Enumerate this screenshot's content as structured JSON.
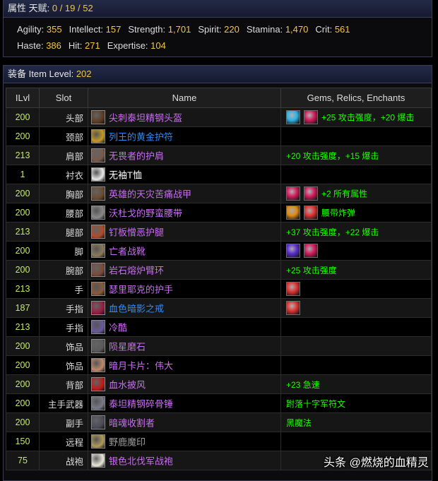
{
  "header": {
    "label": "属性 天赋:",
    "talents": "0 / 19 / 52"
  },
  "stats_row1": [
    {
      "label": "Agility:",
      "value": "355"
    },
    {
      "label": "Intellect:",
      "value": "157"
    },
    {
      "label": "Strength:",
      "value": "1,701"
    },
    {
      "label": "Spirit:",
      "value": "220"
    },
    {
      "label": "Stamina:",
      "value": "1,470"
    },
    {
      "label": "Crit:",
      "value": "561"
    }
  ],
  "stats_row2": [
    {
      "label": "Haste:",
      "value": "386"
    },
    {
      "label": "Hit:",
      "value": "271"
    },
    {
      "label": "Expertise:",
      "value": "104"
    }
  ],
  "equip": {
    "label": "装备 Item Level:",
    "ilvl": "202"
  },
  "columns": [
    "ILvl",
    "Slot",
    "Name",
    "Gems, Relics, Enchants"
  ],
  "colors": {
    "epic": "#c76ef0",
    "rare": "#2a8cff",
    "common": "#ffffff",
    "poor": "#9d9d9d",
    "ilvl": "#c6e86a",
    "enchant": "#1eff00",
    "gold": "#f2c641"
  },
  "rows": [
    {
      "ilvl": "200",
      "slot": "头部",
      "name": "尖刺泰坦精钢头盔",
      "quality": "epic",
      "icon_color": "#5b3a20",
      "gems": [
        "#2bb3e6",
        "#d4195a"
      ],
      "enchant": "+25 攻击强度，+20 爆击"
    },
    {
      "ilvl": "200",
      "slot": "颈部",
      "name": "列王的黄金护符",
      "quality": "rare",
      "icon_color": "#c79a22",
      "gems": [],
      "enchant": ""
    },
    {
      "ilvl": "213",
      "slot": "肩部",
      "name": "无畏者的护肩",
      "quality": "epic",
      "icon_color": "#7a5a4a",
      "gems": [],
      "enchant": "+20 攻击强度，+15 爆击"
    },
    {
      "ilvl": "1",
      "slot": "衬衣",
      "name": "无袖T恤",
      "quality": "common",
      "icon_color": "#e8e8e8",
      "gems": [],
      "enchant": ""
    },
    {
      "ilvl": "200",
      "slot": "胸部",
      "name": "英雄的天灾苦痛战甲",
      "quality": "epic",
      "icon_color": "#6a4a30",
      "gems": [
        "#d4195a",
        "#d4195a"
      ],
      "enchant": "+2 所有属性"
    },
    {
      "ilvl": "200",
      "slot": "腰部",
      "name": "沃杜戈的野蛮腰带",
      "quality": "epic",
      "icon_color": "#8a8a8a",
      "gems": [
        "#e08a12",
        "#e03030"
      ],
      "enchant": "腰带炸弹"
    },
    {
      "ilvl": "213",
      "slot": "腿部",
      "name": "钉板憎恶护腿",
      "quality": "epic",
      "icon_color": "#b04a2a",
      "gems": [],
      "enchant": "+37 攻击强度，+22 爆击"
    },
    {
      "ilvl": "200",
      "slot": "脚",
      "name": "亡者战靴",
      "quality": "epic",
      "icon_color": "#8a7a5a",
      "gems": [
        "#5a2ad4",
        "#d4195a"
      ],
      "enchant": ""
    },
    {
      "ilvl": "200",
      "slot": "腕部",
      "name": "岩石熔炉臂环",
      "quality": "epic",
      "icon_color": "#7a4a3a",
      "gems": [],
      "enchant": "+25 攻击强度"
    },
    {
      "ilvl": "213",
      "slot": "手",
      "name": "瑟里耶克的护手",
      "quality": "epic",
      "icon_color": "#8a5a3a",
      "gems": [
        "#e03030"
      ],
      "enchant": ""
    },
    {
      "ilvl": "187",
      "slot": "手指",
      "name": "血色暗影之戒",
      "quality": "rare",
      "icon_color": "#9a1a40",
      "gems": [
        "#e03030"
      ],
      "enchant": ""
    },
    {
      "ilvl": "213",
      "slot": "手指",
      "name": "冷酷",
      "quality": "epic",
      "icon_color": "#6a5aa0",
      "gems": [],
      "enchant": ""
    },
    {
      "ilvl": "200",
      "slot": "饰品",
      "name": "陨星磨石",
      "quality": "epic",
      "icon_color": "#5a5a5a",
      "gems": [],
      "enchant": ""
    },
    {
      "ilvl": "200",
      "slot": "饰品",
      "name": "暗月卡片：伟大",
      "quality": "epic",
      "icon_color": "#c08a6a",
      "gems": [],
      "enchant": ""
    },
    {
      "ilvl": "200",
      "slot": "背部",
      "name": "血水披风",
      "quality": "epic",
      "icon_color": "#c01818",
      "gems": [],
      "enchant": "+23 急速"
    },
    {
      "ilvl": "200",
      "slot": "主手武器",
      "name": "泰坦精钢碎骨锤",
      "quality": "epic",
      "icon_color": "#7a7a8a",
      "gems": [],
      "enchant": "跗落十字军符文"
    },
    {
      "ilvl": "200",
      "slot": "副手",
      "name": "暗魂收割者",
      "quality": "epic",
      "icon_color": "#4a4a5a",
      "gems": [],
      "enchant": "黑魔法"
    },
    {
      "ilvl": "150",
      "slot": "远程",
      "name": "野鹿魔印",
      "quality": "poor",
      "icon_color": "#b09a5a",
      "gems": [],
      "enchant": ""
    },
    {
      "ilvl": "75",
      "slot": "战袍",
      "name": "银色北伐军战袍",
      "quality": "epic",
      "icon_color": "#e8e8d8",
      "gems": [],
      "enchant": ""
    }
  ],
  "watermark": "头条 @燃烧的血精灵"
}
